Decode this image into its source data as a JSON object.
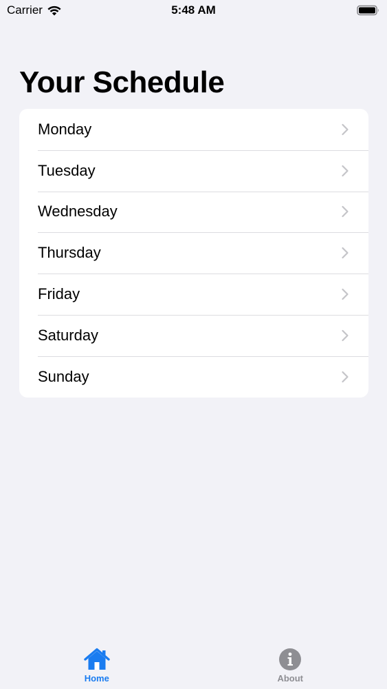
{
  "status_bar": {
    "carrier": "Carrier",
    "time": "5:48 AM"
  },
  "title": "Your Schedule",
  "days": [
    {
      "label": "Monday"
    },
    {
      "label": "Tuesday"
    },
    {
      "label": "Wednesday"
    },
    {
      "label": "Thursday"
    },
    {
      "label": "Friday"
    },
    {
      "label": "Saturday"
    },
    {
      "label": "Sunday"
    }
  ],
  "tabs": [
    {
      "label": "Home",
      "icon": "house-icon",
      "selected": true
    },
    {
      "label": "About",
      "icon": "info-icon",
      "selected": false
    }
  ],
  "colors": {
    "accent": "#1a7cf0",
    "inactive": "#8e8e93",
    "background": "#f2f2f7"
  }
}
